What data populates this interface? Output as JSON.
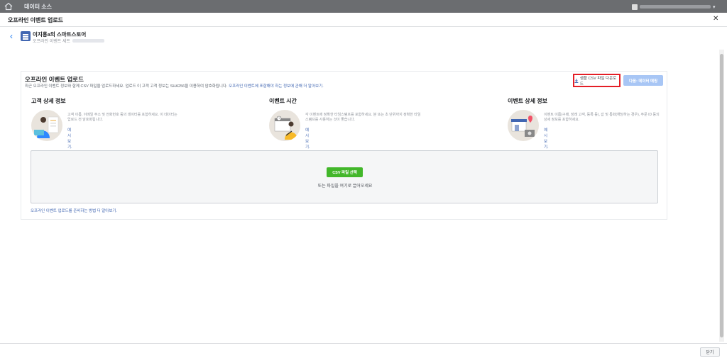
{
  "topbar": {
    "title": "데이터 소스"
  },
  "modal": {
    "title": "오프라인 이벤트 업로드",
    "store_name": "이지홍a의 스마트스토어",
    "store_sub": "오프라인 이벤트 세트",
    "close_label": "닫기"
  },
  "card": {
    "title": "오프라인 이벤트 업로드",
    "desc": "최근 오프라인 이벤트 정보와 함께 CSV 파일을 업로드하세요. 업로드 이 고객 고객 정보는 SHA256을 이용하여 암호화됩니다.",
    "desc_link": "오프라인 이벤트에 포함해야 하는 정보에 관해 더 알아보기.",
    "download_label": "샘플 CSV 파일 다운로드",
    "next_label": "다음: 데이터 매핑",
    "footer_link": "오프라인 이벤트 업로드를 준비하는 방법 더 알아보기."
  },
  "sections": [
    {
      "title": "고객 상세 정보",
      "desc": "고객 이름, 이메일 주소 및 전화번호 등의 데이터를 포함하세요. 이 데이터는 업로드 전 암호화됩니다.",
      "link": "예시 보기."
    },
    {
      "title": "이벤트 시간",
      "desc": "각 이벤트에 정확한 타임스탬프를 포함하세요. 분 또는 초 단위까지 정확한 타임스탬프를 사용하는 것이 좋습니다.",
      "link": "예시 보기."
    },
    {
      "title": "이벤트 상세 정보",
      "desc": "이벤트 이름(구매, 장래 고객, 등록 등), 값 및 통화(해당하는 경우), 주문 ID 등의 상세 정보를 포함하세요.",
      "link": "예시 보기."
    }
  ],
  "dropzone": {
    "button_label": "CSV 파일 선택",
    "text": "또는 파일을 여기로 끌어오세요"
  },
  "colors": {
    "accent": "#4267b2",
    "highlight": "#e41e26",
    "green": "#42b72a",
    "next_disabled": "#a8c6f5"
  }
}
